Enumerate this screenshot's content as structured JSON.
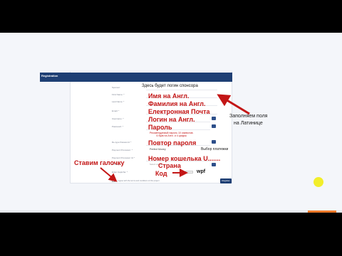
{
  "form": {
    "header": "Registration",
    "fields": [
      {
        "label": "Sponsor:"
      },
      {
        "label": "First Name: *"
      },
      {
        "label": "Last Name: *"
      },
      {
        "label": "Email: *"
      },
      {
        "label": "Username: *"
      },
      {
        "label": "Password: *"
      },
      {
        "label": ""
      },
      {
        "label": "Re-type Password: *"
      },
      {
        "label": "Payment Processor: *"
      },
      {
        "label": "Payment Processor Id: *"
      },
      {
        "label": "Country: *"
      },
      {
        "label": "Enter Captcha: *"
      }
    ],
    "processor_value": "Perfect Money",
    "country_value": "Select country",
    "captcha_code": "wpf",
    "register_label": "Register",
    "terms_text": "I agree with the terms and conditions of this project"
  },
  "annotations": {
    "sponsor": "Здесь будет логин спонсора",
    "first_name": "Имя на Англ.",
    "last_name": "Фамилия на Англ.",
    "email": "Електронная Почта",
    "login": "Логин на Англ.",
    "password": "Пароль",
    "password_hint_1": "Рекомендуемый пароль 10 символов.",
    "password_hint_2": "6 букв на Англ. и 4 цифры",
    "repeat_password": "Повтор пароля",
    "processor": "Выбор платежки",
    "wallet": "Номер кошелька U.......",
    "country": "Страна",
    "code": "Код",
    "checkbox": "Ставим галочку",
    "fill_latin_1": "Заполняем поля",
    "fill_latin_2": "на Латинице"
  },
  "colors": {
    "header_blue": "#1e3f74",
    "annotation_red": "#c31616",
    "cursor_yellow": "#f2ee2a"
  }
}
